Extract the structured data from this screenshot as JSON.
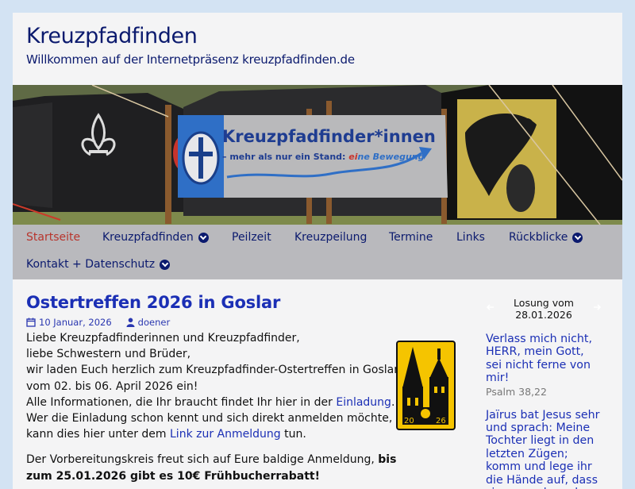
{
  "site": {
    "title": "Kreuzpfadfinden",
    "description": "Willkommen auf der Internetpräsenz kreuzpfadfinden.de"
  },
  "banner": {
    "headline": "Kreuzpfadfinder*innen",
    "tagline_prefix": "– mehr als nur ein Stand: ",
    "tagline_emph1": "ei",
    "tagline_emph2": "ne",
    "tagline_emph3": " Bewegung"
  },
  "nav": {
    "items": [
      {
        "label": "Startseite",
        "active": true
      },
      {
        "label": "Kreuzpfadfinden",
        "has_submenu": true
      },
      {
        "label": "Peilzeit"
      },
      {
        "label": "Kreuzpeilung"
      },
      {
        "label": "Termine"
      },
      {
        "label": "Links"
      },
      {
        "label": "Rückblicke",
        "has_submenu": true
      },
      {
        "label": "Kontakt + Datenschutz",
        "has_submenu": true
      }
    ]
  },
  "post": {
    "title": "Ostertreffen 2026 in Goslar",
    "date": "10 Januar, 2026",
    "author": "doener",
    "lines": [
      "Liebe Kreuzpfadfinderinnen und Kreuzpfadfinder,",
      "liebe Schwestern und Brüder,",
      "wir laden Euch herzlich zum Kreuzpfadfinder-Ostertreffen in Goslar",
      "vom 02. bis 06. April 2026 ein!",
      "Alle Informationen, die Ihr braucht findet Ihr hier in der "
    ],
    "link_einladung": "Einladung",
    "line5_end": ".",
    "line6": "Wer die Einladung schon kennt und sich direkt anmelden möchte,",
    "line7_start": "kann dies hier unter dem ",
    "link_anmeldung": "Link zur Anmeldung",
    "line7_end": " tun.",
    "para2_start": "Der Vorbereitungskreis freut sich auf Eure baldige Anmeldung, ",
    "para2_bold": "bis zum 25.01.2026 gibt es 10€ Frühbucherrabatt!",
    "logo_year_left": "20",
    "logo_year_right": "26"
  },
  "sidebar": {
    "losung_head_line1": "Losung vom",
    "losung_head_line2": "28.01.2026",
    "text1": "Verlass mich nicht, HERR, mein Gott, sei nicht ferne von mir!",
    "ref1": "Psalm 38,22",
    "text2": "Jaïrus bat Jesus sehr und sprach: Meine Tochter liegt in den letzten Zügen; komm und lege ihr die Hände auf, dass sie gesund werde und lebe."
  },
  "colors": {
    "accent": "#1b2fb5",
    "title": "#0b1a6e",
    "active_nav": "#b8352d",
    "nav_bg": "#b9b9bd",
    "page_bg": "#d3e3f3",
    "logo_yellow": "#f5c400"
  }
}
